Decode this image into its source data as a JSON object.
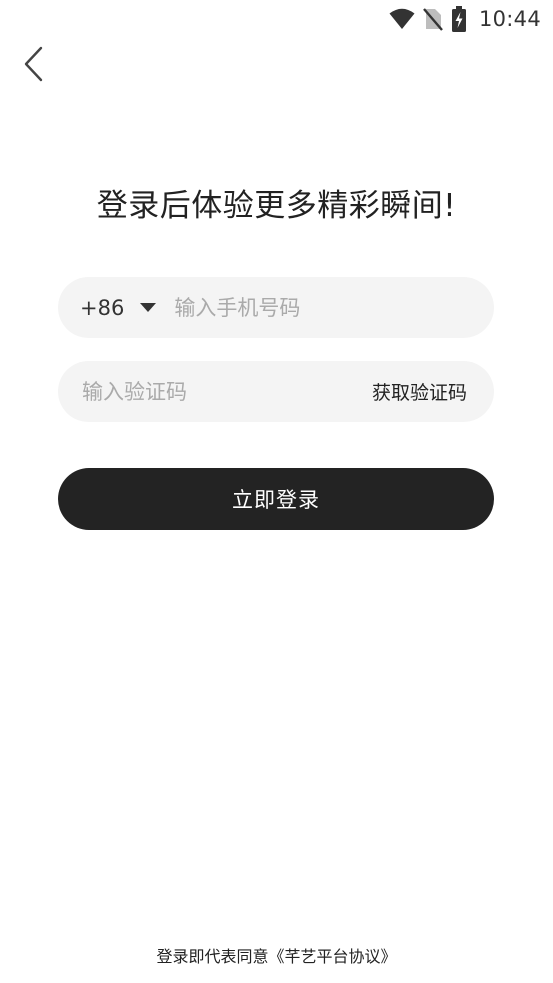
{
  "status_bar": {
    "time": "10:44",
    "icons": [
      "wifi-icon",
      "no-sim-icon",
      "battery-charging-icon"
    ]
  },
  "nav": {
    "back_icon": "chevron-left-icon"
  },
  "title": "登录后体验更多精彩瞬间!",
  "phone_field": {
    "country_code": "+86",
    "placeholder": "输入手机号码",
    "value": ""
  },
  "code_field": {
    "placeholder": "输入验证码",
    "value": "",
    "get_code_label": "获取验证码"
  },
  "login_button_label": "立即登录",
  "agreement": {
    "prefix": "登录即代表同意",
    "link_text": "《芊艺平台协议》"
  },
  "colors": {
    "primary_button": "#232323",
    "field_background": "#f4f4f4",
    "placeholder": "#aaaaaa"
  }
}
